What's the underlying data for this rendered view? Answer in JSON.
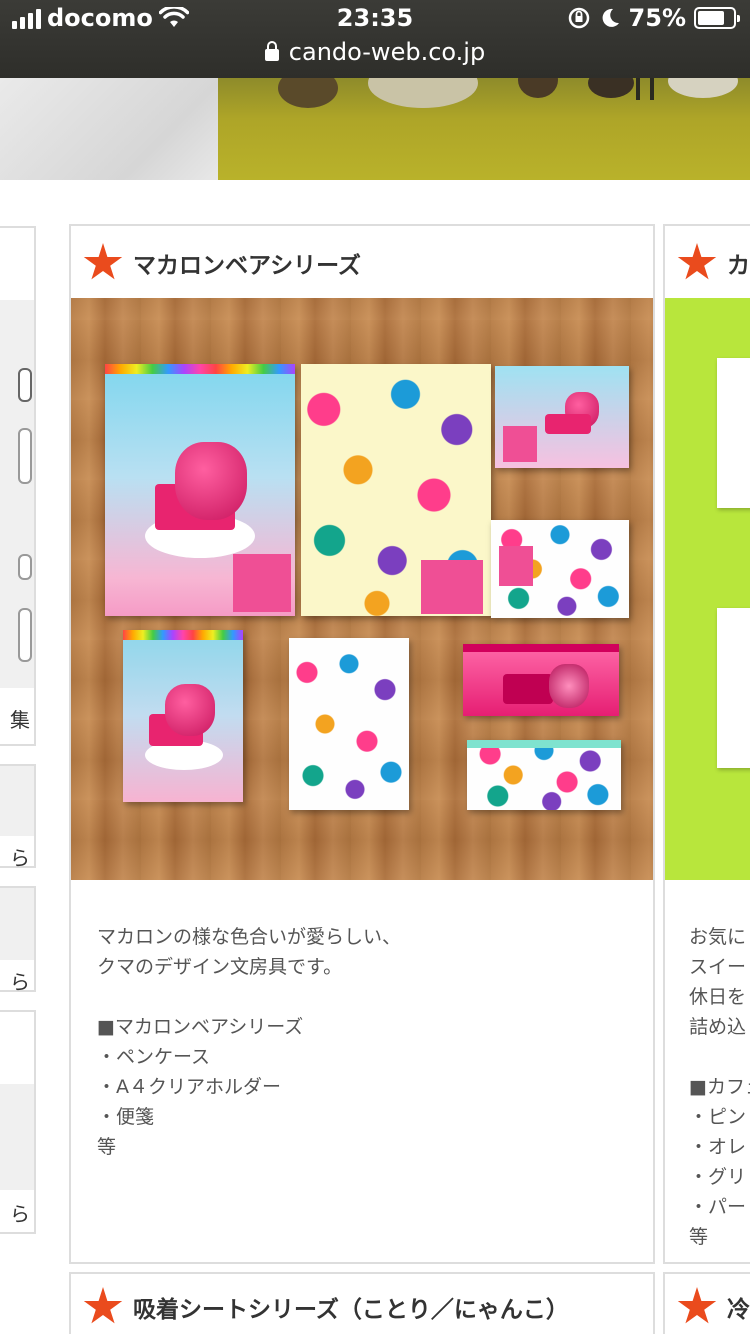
{
  "status_bar": {
    "carrier": "docomo",
    "time": "23:35",
    "battery": "75%",
    "battery_level": 0.75,
    "url": "cando-web.co.jp"
  },
  "left_column": {
    "tail_labels": [
      "集",
      "ら",
      "ら",
      "ら"
    ]
  },
  "cards": [
    {
      "title": "マカロンベアシリーズ",
      "description": [
        "マカロンの様な色合いが愛らしい、",
        "クマのデザイン文房具です。",
        "",
        "■マカロンベアシリーズ",
        "・ペンケース",
        "・A４クリアホルダー",
        "・便箋",
        "等"
      ]
    },
    {
      "title": "カフ",
      "description": [
        "お気に",
        "スイー",
        "休日を",
        "詰め込",
        "",
        "■カフェ",
        "・ピン",
        "・オレ",
        "・グリ",
        "・パー",
        "等"
      ]
    },
    {
      "title": "吸着シートシリーズ（ことり／にゃんこ）"
    },
    {
      "title": "冷蔵"
    }
  ],
  "colors": {
    "star": "#ea4b1d",
    "border": "#dddddd",
    "text": "#555555"
  },
  "icons": [
    "signal-icon",
    "wifi-icon",
    "lock-icon",
    "rotation-lock-icon",
    "moon-icon",
    "battery-icon",
    "star-icon"
  ]
}
